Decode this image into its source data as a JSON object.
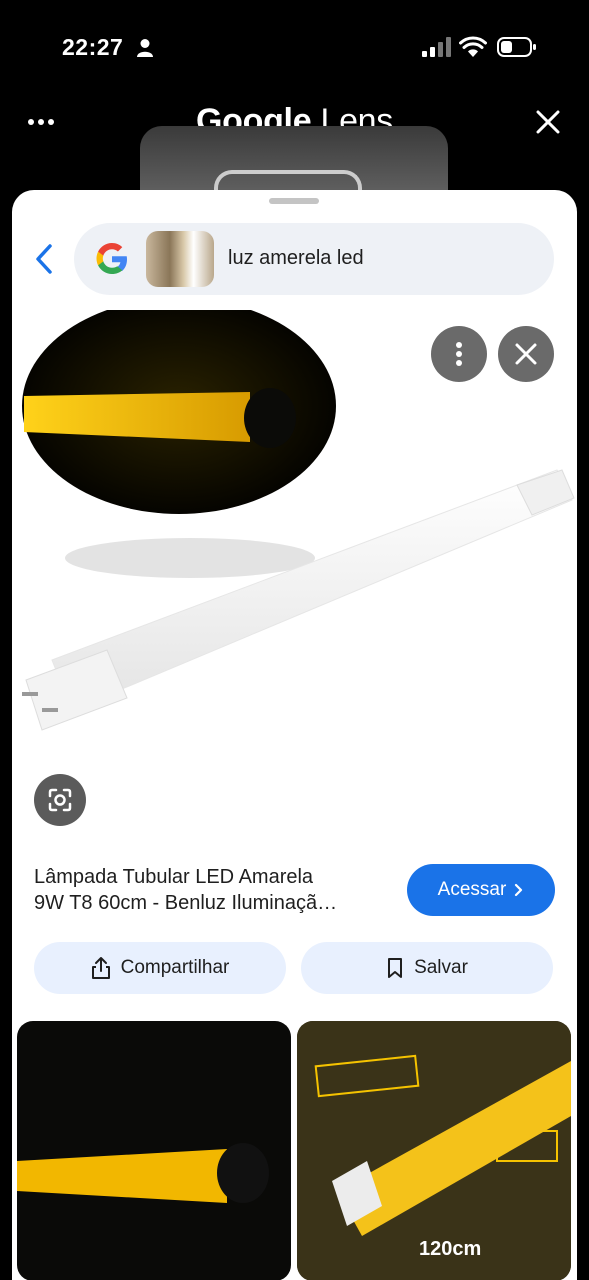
{
  "status_bar": {
    "time": "22:27"
  },
  "lens_bar": {
    "title_bold": "Google",
    "title_light": "Lens"
  },
  "search": {
    "query": "luz amerela led"
  },
  "result": {
    "title_line1": "Lâmpada Tubular LED Amarela",
    "title_line2": "9W T8 60cm - Benluz Iluminaçã…",
    "visit_label": "Acessar",
    "share_label": "Compartilhar",
    "save_label": "Salvar"
  },
  "grid": {
    "item2_label": "120cm"
  },
  "colors": {
    "accent": "#1a73e8",
    "pill_bg": "#e8f0fe",
    "lamp_yellow": "#f2b700"
  },
  "icons": [
    "person-icon",
    "signal-icon",
    "wifi-icon",
    "battery-icon",
    "more-icon",
    "close-icon",
    "back-icon",
    "google-logo-icon",
    "more-vert-icon",
    "lens-scan-icon",
    "chevron-right-icon",
    "share-icon",
    "bookmark-icon"
  ]
}
